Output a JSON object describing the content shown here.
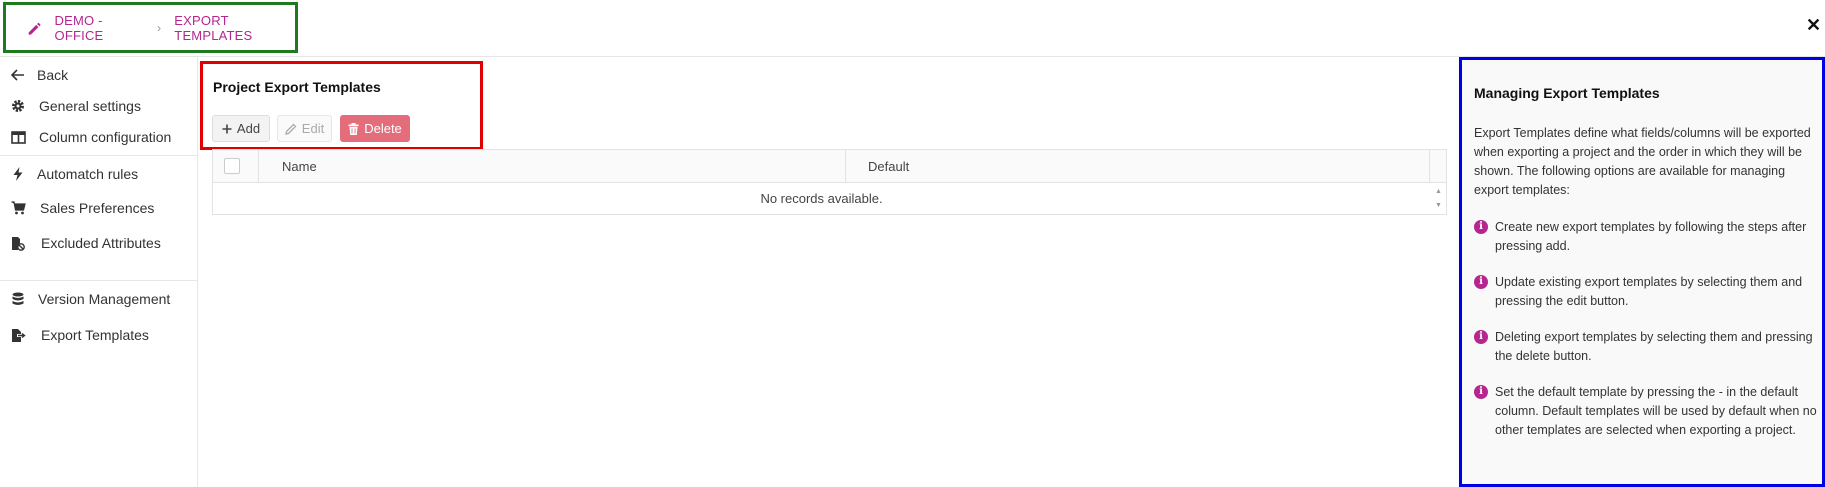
{
  "breadcrumb": {
    "root": "DEMO - OFFICE",
    "separator": "›",
    "current": "EXPORT TEMPLATES"
  },
  "header": {
    "close_label": "✕"
  },
  "sidebar": {
    "items": [
      {
        "label": "Back",
        "icon": "arrow-left-icon"
      },
      {
        "label": "General settings",
        "icon": "gear-icon"
      },
      {
        "label": "Column configuration",
        "icon": "columns-icon"
      },
      {
        "label": "Automatch rules",
        "icon": "bolt-icon"
      },
      {
        "label": "Sales Preferences",
        "icon": "cart-icon"
      },
      {
        "label": "Excluded Attributes",
        "icon": "excluded-file-icon"
      },
      {
        "label": "Version Management",
        "icon": "database-icon"
      },
      {
        "label": "Export Templates",
        "icon": "export-file-icon"
      }
    ]
  },
  "main": {
    "title": "Project Export Templates",
    "toolbar": {
      "add_label": "Add",
      "edit_label": "Edit",
      "delete_label": "Delete"
    },
    "grid": {
      "columns": [
        "Name",
        "Default"
      ],
      "rows": [],
      "empty_text": "No records available."
    }
  },
  "help": {
    "title": "Managing Export Templates",
    "intro": "Export Templates define what fields/columns will be exported when exporting a project and the order in which they will be shown. The following options are available for managing export templates:",
    "items": [
      "Create new export templates by following the steps after pressing add.",
      "Update existing export templates by selecting them and pressing the edit button.",
      "Deleting export templates by selecting them and pressing the delete button.",
      "Set the default template by pressing the - in the default column. Default templates will be used by default when no other templates are selected when exporting a project."
    ]
  },
  "colors": {
    "accent": "#b5268f",
    "delete": "#e46d7b",
    "annotation_green": "#1f7a1f",
    "annotation_red": "#e00000",
    "annotation_blue": "#0000e6"
  }
}
